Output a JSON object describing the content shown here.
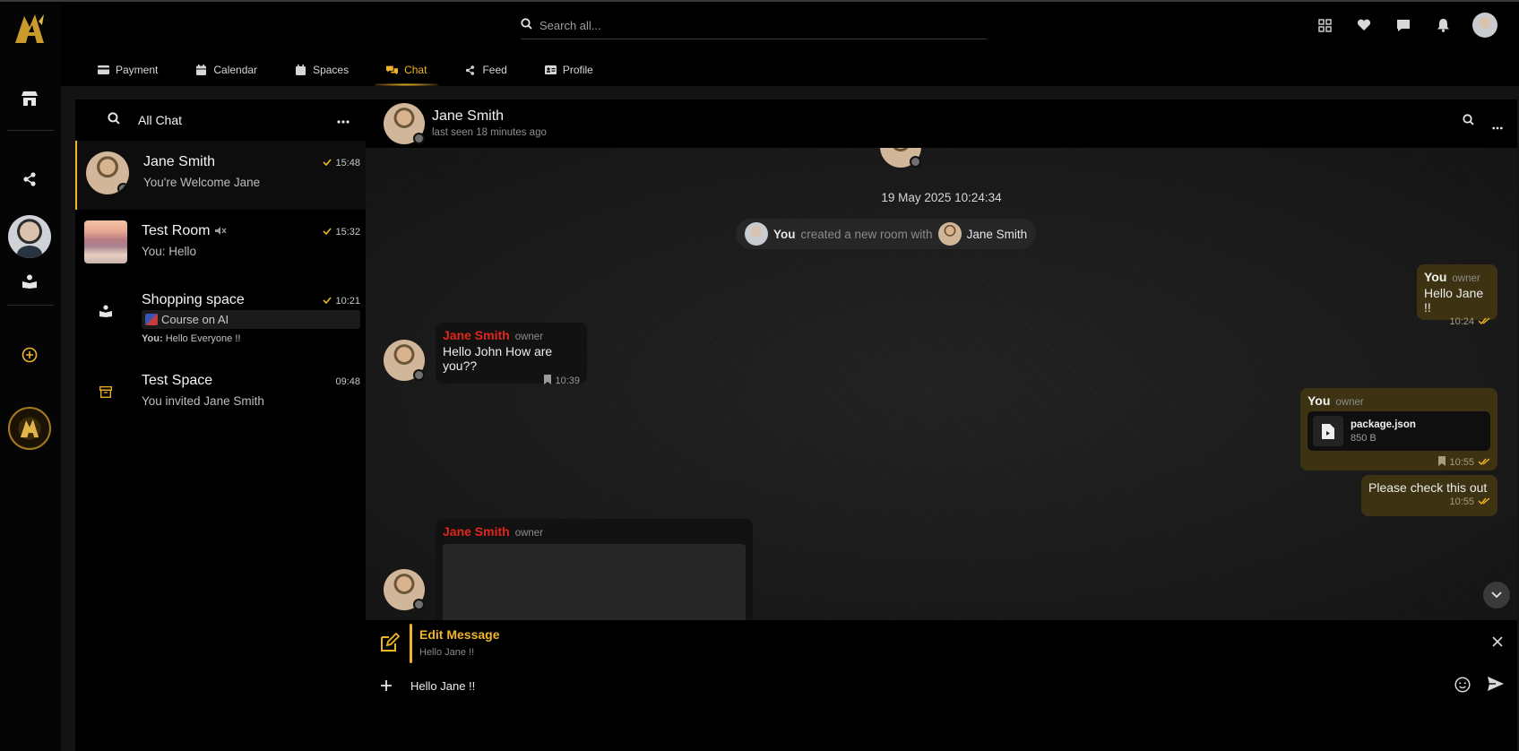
{
  "search": {
    "placeholder": "Search all..."
  },
  "tabs": [
    {
      "label": "Payment",
      "icon": "credit-card-icon"
    },
    {
      "label": "Calendar",
      "icon": "calendar-icon"
    },
    {
      "label": "Spaces",
      "icon": "spaces-icon"
    },
    {
      "label": "Chat",
      "icon": "chat-bubbles-icon",
      "active": true
    },
    {
      "label": "Feed",
      "icon": "share-icon"
    },
    {
      "label": "Profile",
      "icon": "id-card-icon"
    }
  ],
  "chatlist": {
    "title": "All Chat",
    "items": [
      {
        "name": "Jane Smith",
        "preview": "You're Welcome Jane",
        "time": "15:48",
        "read": true,
        "active": true
      },
      {
        "name": "Test Room",
        "preview": "You: Hello",
        "time": "15:32",
        "read": true,
        "muted": true
      },
      {
        "name": "Shopping space",
        "linked": "Course on AI",
        "preview_prefix": "You:",
        "preview": "Hello Everyone !!",
        "time": "10:21",
        "read": true
      },
      {
        "name": "Test Space",
        "preview": "You invited Jane Smith",
        "time": "09:48"
      }
    ]
  },
  "chat": {
    "name": "Jane Smith",
    "status": "last seen 18 minutes ago",
    "date_divider": "19 May 2025 10:24:34",
    "system": {
      "actor": "You",
      "action": "created a new room with",
      "target": "Jane Smith"
    },
    "messages": [
      {
        "author": "You",
        "role": "owner",
        "text": "Hello Jane !!",
        "time": "10:24"
      },
      {
        "author": "Jane Smith",
        "role": "owner",
        "text": "Hello John How are you??",
        "time": "10:39"
      },
      {
        "author": "You",
        "role": "owner",
        "file_name": "package.json",
        "file_size": "850 B",
        "time": "10:55"
      },
      {
        "text": "Please check this out",
        "time": "10:55"
      },
      {
        "author": "Jane Smith",
        "role": "owner"
      }
    ]
  },
  "edit": {
    "title": "Edit Message",
    "original": "Hello Jane !!"
  },
  "composer": {
    "value": "Hello Jane !!"
  },
  "colors": {
    "accent": "#f0b526",
    "author_in": "#e0261c",
    "bubble_out": "#3d3211"
  }
}
